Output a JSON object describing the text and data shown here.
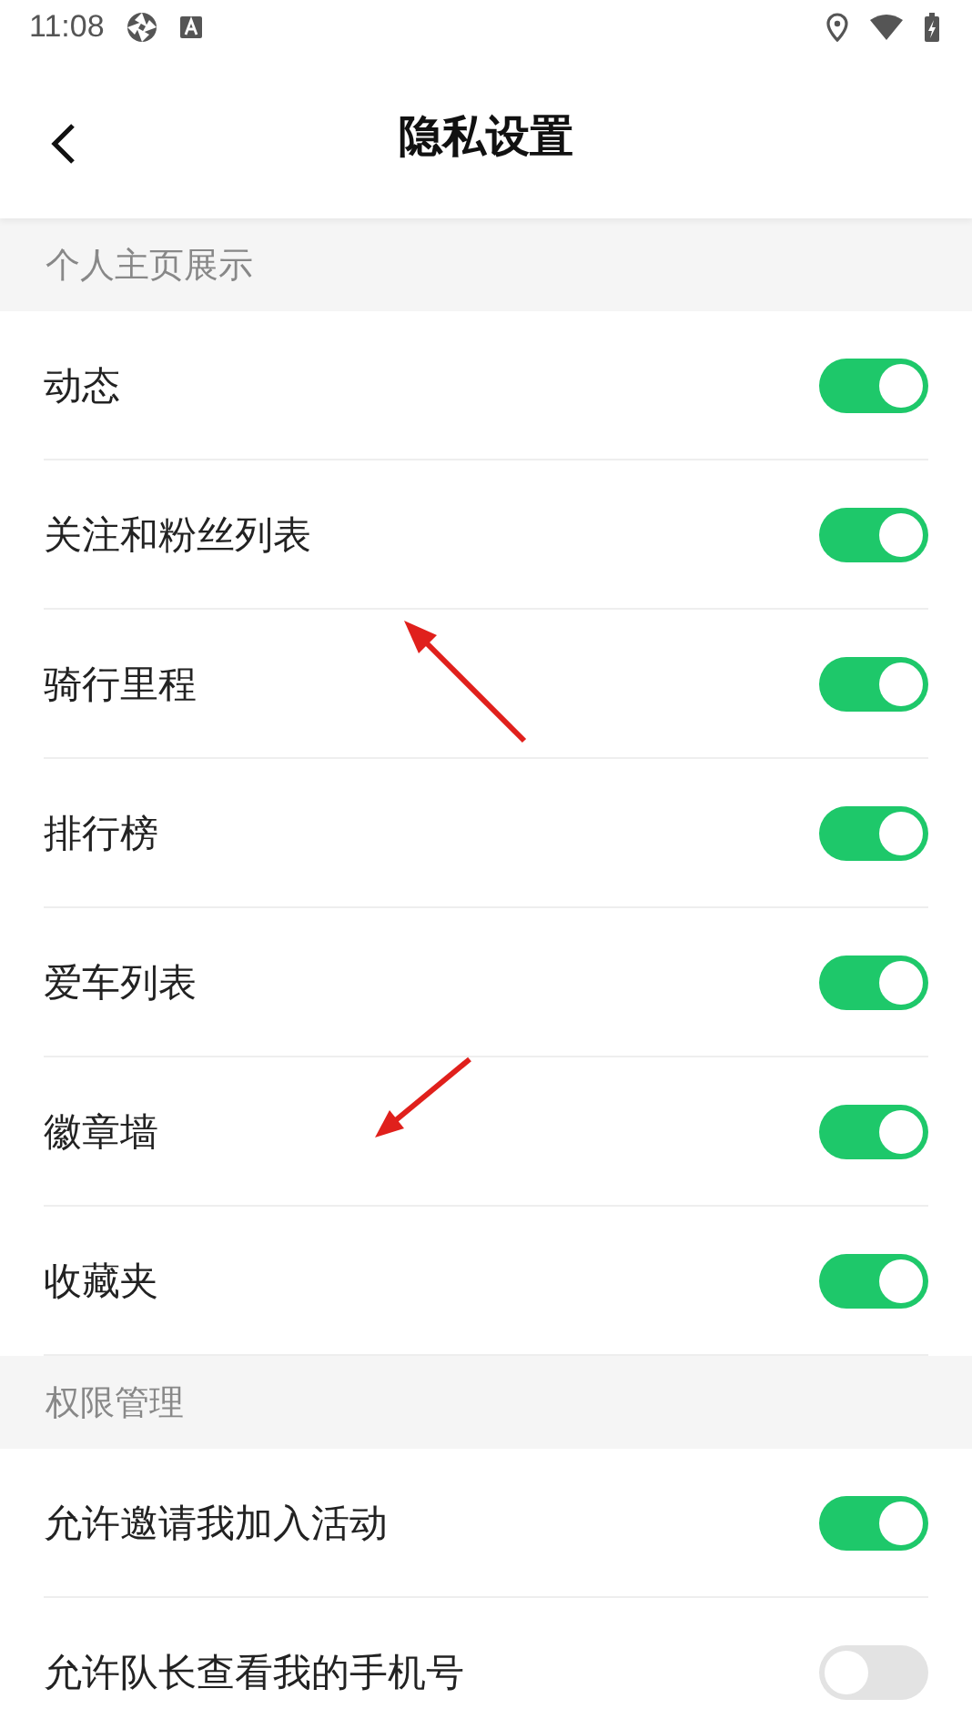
{
  "status_bar": {
    "time": "11:08"
  },
  "header": {
    "title": "隐私设置"
  },
  "sections": [
    {
      "title": "个人主页展示",
      "items": [
        {
          "label": "动态",
          "on": true
        },
        {
          "label": "关注和粉丝列表",
          "on": true
        },
        {
          "label": "骑行里程",
          "on": true
        },
        {
          "label": "排行榜",
          "on": true
        },
        {
          "label": "爱车列表",
          "on": true
        },
        {
          "label": "徽章墙",
          "on": true
        },
        {
          "label": "收藏夹",
          "on": true
        }
      ]
    },
    {
      "title": "权限管理",
      "items": [
        {
          "label": "允许邀请我加入活动",
          "on": true
        },
        {
          "label": "允许队长查看我的手机号",
          "on": false
        }
      ]
    }
  ]
}
